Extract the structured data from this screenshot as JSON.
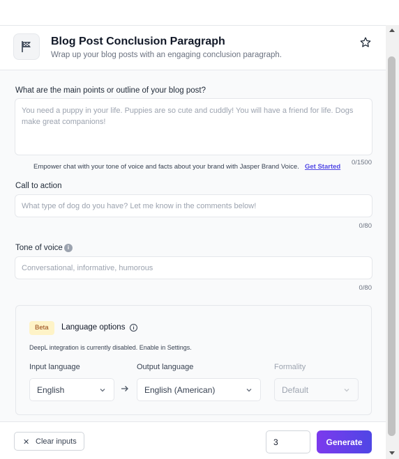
{
  "template": {
    "title": "Blog Post Conclusion Paragraph",
    "subtitle": "Wrap up your blog posts with an engaging conclusion paragraph.",
    "icon": "flag-icon",
    "favorite_icon": "star-icon"
  },
  "fields": {
    "main_points": {
      "label": "What are the main points or outline of your blog post?",
      "placeholder": "You need a puppy in your life. Puppies are so cute and cuddly! You will have a friend for life. Dogs make great companions!",
      "value": "",
      "counter": "0/1500"
    },
    "brand_voice": {
      "note": "Empower chat with your tone of voice and facts about your brand with Jasper Brand Voice.",
      "link": "Get Started"
    },
    "call_to_action": {
      "label": "Call to action",
      "placeholder": "What type of dog do you have? Let me know in the comments below!",
      "value": "",
      "counter": "0/80"
    },
    "tone_of_voice": {
      "label": "Tone of voice",
      "info_icon": "i",
      "placeholder": "Conversational, informative, humorous",
      "value": "",
      "counter": "0/80"
    }
  },
  "language": {
    "badge": "Beta",
    "title": "Language options",
    "info_icon": "i",
    "note": "DeepL integration is currently disabled. Enable in Settings.",
    "input_label": "Input language",
    "input_value": "English",
    "output_label": "Output language",
    "output_value": "English (American)",
    "formality_label": "Formality",
    "formality_value": "Default"
  },
  "footer": {
    "clear_label": "Clear inputs",
    "clear_icon": "✕",
    "output_count": "3",
    "generate_label": "Generate"
  },
  "colors": {
    "accent_start": "#7c3aed",
    "accent_end": "#4f46e5",
    "link": "#4f46e5",
    "beta_bg": "#fef3c7"
  }
}
